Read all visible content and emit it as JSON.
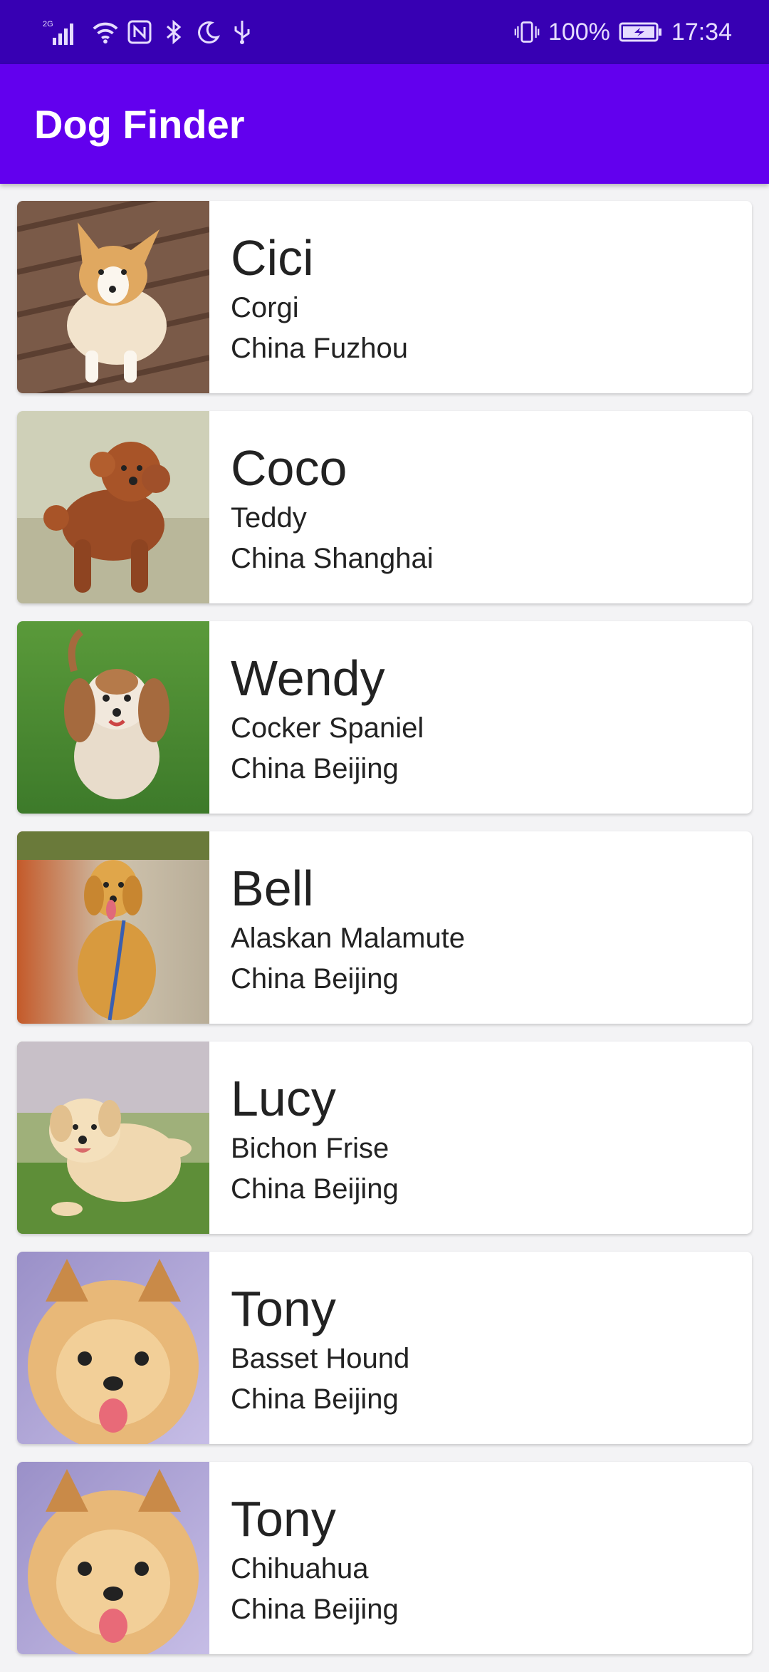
{
  "status_bar": {
    "network": "2G",
    "battery": "100%",
    "time": "17:34",
    "icons": [
      "signal-icon",
      "wifi-icon",
      "nfc-icon",
      "bluetooth-icon",
      "moon-icon",
      "usb-icon",
      "vibrate-icon",
      "battery-icon"
    ]
  },
  "app_bar": {
    "title": "Dog Finder",
    "color": "#6200ee",
    "status_color": "#3700b3"
  },
  "dogs": [
    {
      "name": "Cici",
      "breed": "Corgi",
      "location": "China Fuzhou",
      "photo": "corgi-puppy-photo"
    },
    {
      "name": "Coco",
      "breed": "Teddy",
      "location": "China Shanghai",
      "photo": "poodle-photo"
    },
    {
      "name": "Wendy",
      "breed": "Cocker Spaniel",
      "location": "China Beijing",
      "photo": "cocker-spaniel-photo"
    },
    {
      "name": "Bell",
      "breed": "Alaskan Malamute",
      "location": "China Beijing",
      "photo": "golden-retriever-photo"
    },
    {
      "name": "Lucy",
      "breed": "Bichon Frise",
      "location": "China Beijing",
      "photo": "golden-puppy-photo"
    },
    {
      "name": "Tony",
      "breed": "Basset Hound",
      "location": "China Beijing",
      "photo": "pomeranian-photo"
    },
    {
      "name": "Tony",
      "breed": "Chihuahua",
      "location": "China Beijing",
      "photo": "pomeranian-photo"
    }
  ]
}
